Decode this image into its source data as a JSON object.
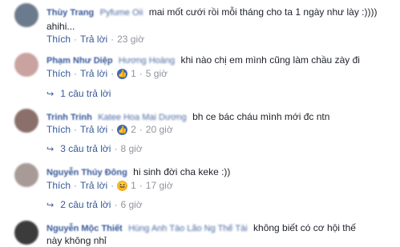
{
  "comments": [
    {
      "author": "Thùy Trang",
      "tagged": "Pyfume Oii",
      "text": "mai mốt cưới rồi mỗi tháng cho ta 1 ngày như lày :))))",
      "cont": "ahihi...",
      "like": "Thích",
      "reply": "Trả lời",
      "time": "23 giờ",
      "avatar_color": "#6b7a8c"
    },
    {
      "author": "Phạm Như Diệp",
      "tagged": "Hương Hoàng",
      "text": "khi nào chị em mình cũng làm chầu zày đi",
      "like": "Thích",
      "reply": "Trả lời",
      "reactions": "1",
      "time": "5 giờ",
      "replies": "1 câu trả lời",
      "avatar_color": "#c9a3a0"
    },
    {
      "author": "Trinh Trinh",
      "tagged": "Katee Hoa Mai Dương",
      "text": "bh ce bác cháu mình mới đc ntn",
      "like": "Thích",
      "reply": "Trả lời",
      "reactions": "2",
      "time": "20 giờ",
      "replies": "3 câu trả lời",
      "replies_time": "8 giờ",
      "avatar_color": "#8a6f6a"
    },
    {
      "author": "Nguyễn Thúy Đông",
      "text": "hi sinh đời cha keke :))",
      "like": "Thích",
      "reply": "Trả lời",
      "reactions": "1",
      "time": "17 giờ",
      "replies": "2 câu trả lời",
      "replies_time": "6 giờ",
      "avatar_color": "#a89a96"
    },
    {
      "author": "Nguyễn Mộc Thiết",
      "tagged": "Hùng Anh Táo Lão Ng Thế Tài",
      "text": "không biết có cơ hội thế",
      "cont": "này không nhỉ",
      "avatar_color": "#3b3b3b"
    }
  ],
  "icons": {
    "like": "thumbs-up-icon",
    "haha": "laughing-face-icon",
    "reply_arrow": "reply-arrow-icon"
  }
}
